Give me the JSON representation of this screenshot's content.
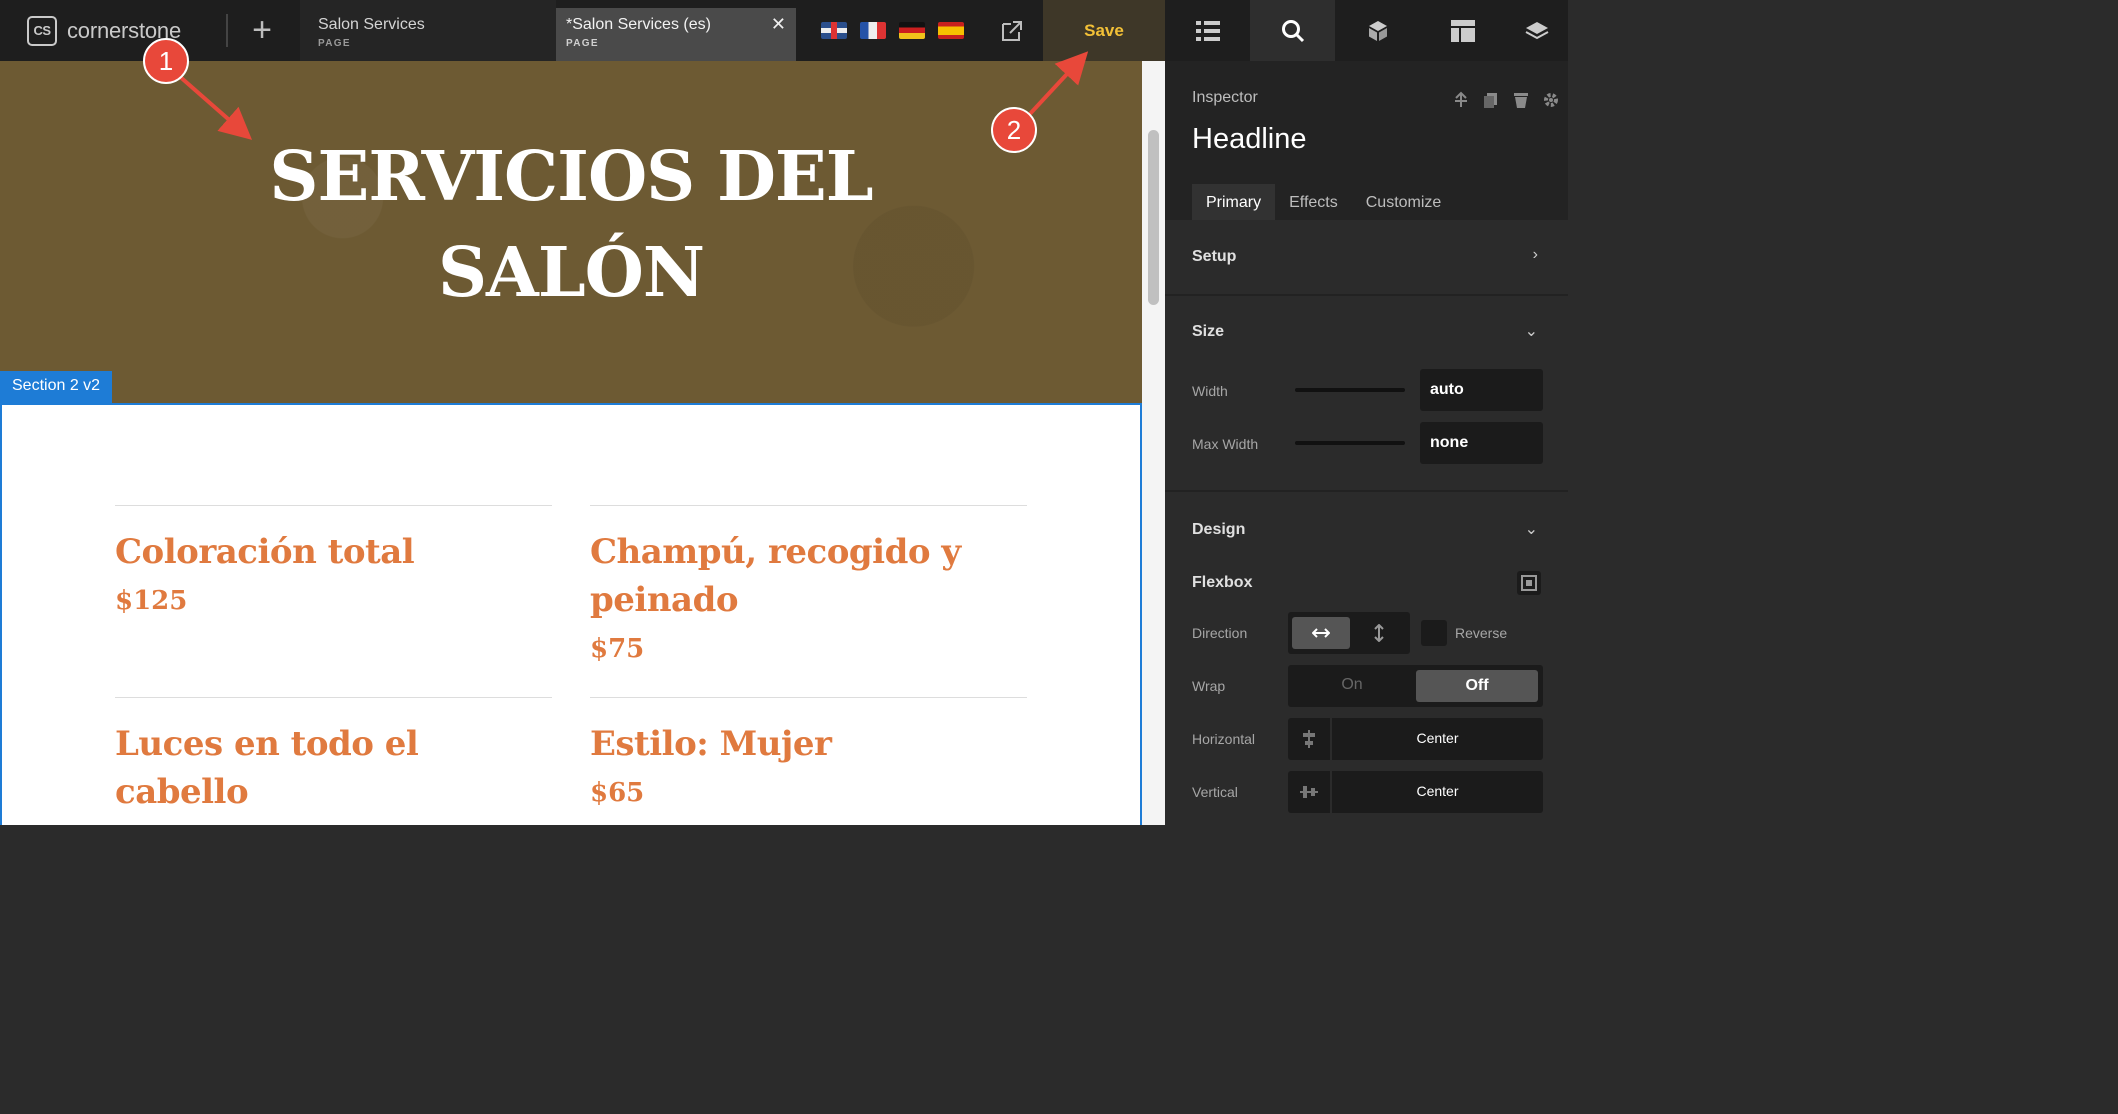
{
  "topbar": {
    "logo_badge": "CS",
    "logo_text": "cornerstone",
    "tabs": [
      {
        "title": "Salon Services",
        "sub": "PAGE"
      },
      {
        "title": "*Salon Services (es)",
        "sub": "PAGE"
      }
    ],
    "save_label": "Save",
    "flags": [
      "uk-flag",
      "fr-flag",
      "de-flag",
      "es-flag"
    ]
  },
  "canvas": {
    "hero_line1": "SERVICIOS DEL",
    "hero_line2": "SALÓN",
    "section_tag": "Section 2 v2",
    "services": [
      {
        "title": "Coloración total",
        "price": "$125"
      },
      {
        "title": "Champú, recogido y peinado",
        "price": "$75"
      },
      {
        "title": "Luces en todo el cabello",
        "price": ""
      },
      {
        "title": "Estilo: Mujer",
        "price": "$65"
      }
    ]
  },
  "annotations": {
    "one": "1",
    "two": "2"
  },
  "inspector": {
    "label": "Inspector",
    "title": "Headline",
    "tabs": [
      "Primary",
      "Effects",
      "Customize"
    ],
    "setup": "Setup",
    "size": "Size",
    "width_label": "Width",
    "width_value": "auto",
    "maxwidth_label": "Max Width",
    "maxwidth_value": "none",
    "design": "Design",
    "flexbox": "Flexbox",
    "direction_label": "Direction",
    "reverse_label": "Reverse",
    "wrap_label": "Wrap",
    "wrap_on": "On",
    "wrap_off": "Off",
    "horizontal_label": "Horizontal",
    "horizontal_value": "Center",
    "vertical_label": "Vertical",
    "vertical_value": "Center"
  },
  "colors": {
    "accent": "#f2c037",
    "selection": "#1e7cd6",
    "service_text": "#e07a3f",
    "annotation": "#e8483a"
  }
}
